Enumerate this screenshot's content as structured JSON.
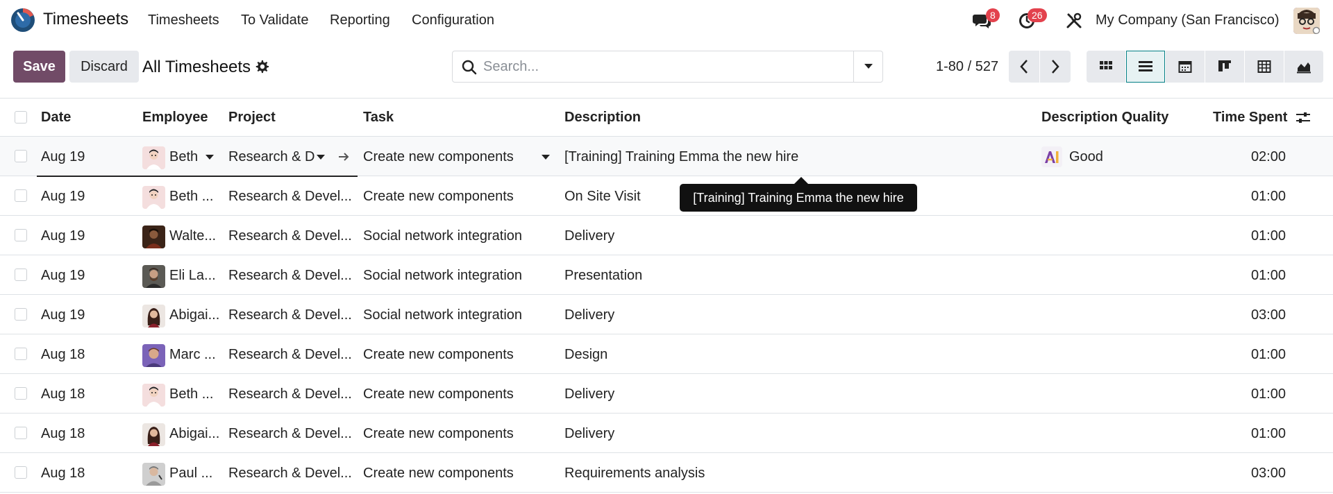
{
  "app": {
    "name": "Timesheets"
  },
  "nav": {
    "items": [
      "Timesheets",
      "To Validate",
      "Reporting",
      "Configuration"
    ]
  },
  "systray": {
    "messages_count": "8",
    "activities_count": "26",
    "company": "My Company (San Francisco)"
  },
  "controls": {
    "save_label": "Save",
    "discard_label": "Discard",
    "view_title": "All Timesheets",
    "search_placeholder": "Search...",
    "pager": "1-80 / 527"
  },
  "table": {
    "headers": [
      "Date",
      "Employee",
      "Project",
      "Task",
      "Description",
      "Description Quality",
      "Time Spent"
    ],
    "rows": [
      {
        "date": "Aug 19",
        "employee": "Beth |",
        "project": "Research & De",
        "task": "Create new components",
        "description": "[Training] Training Emma the new hire",
        "quality": "Good",
        "time": "02:00"
      },
      {
        "date": "Aug 19",
        "employee": "Beth ...",
        "project": "Research & Devel...",
        "task": "Create new components",
        "description": "On Site Visit",
        "quality": "",
        "time": "01:00"
      },
      {
        "date": "Aug 19",
        "employee": "Walte...",
        "project": "Research & Devel...",
        "task": "Social network integration",
        "description": "Delivery",
        "quality": "",
        "time": "01:00"
      },
      {
        "date": "Aug 19",
        "employee": "Eli La...",
        "project": "Research & Devel...",
        "task": "Social network integration",
        "description": "Presentation",
        "quality": "",
        "time": "01:00"
      },
      {
        "date": "Aug 19",
        "employee": "Abigai...",
        "project": "Research & Devel...",
        "task": "Social network integration",
        "description": "Delivery",
        "quality": "",
        "time": "03:00"
      },
      {
        "date": "Aug 18",
        "employee": "Marc ...",
        "project": "Research & Devel...",
        "task": "Create new components",
        "description": "Design",
        "quality": "",
        "time": "01:00"
      },
      {
        "date": "Aug 18",
        "employee": "Beth ...",
        "project": "Research & Devel...",
        "task": "Create new components",
        "description": "Delivery",
        "quality": "",
        "time": "01:00"
      },
      {
        "date": "Aug 18",
        "employee": "Abigai...",
        "project": "Research & Devel...",
        "task": "Create new components",
        "description": "Delivery",
        "quality": "",
        "time": "01:00"
      },
      {
        "date": "Aug 18",
        "employee": "Paul ...",
        "project": "Research & Devel...",
        "task": "Create new components",
        "description": "Requirements analysis",
        "quality": "",
        "time": "03:00"
      }
    ]
  },
  "tooltip": {
    "text": "[Training] Training Emma the new hire"
  },
  "colors": {
    "primary": "#714b67",
    "accent": "#017e84",
    "badge": "#e3424d"
  }
}
